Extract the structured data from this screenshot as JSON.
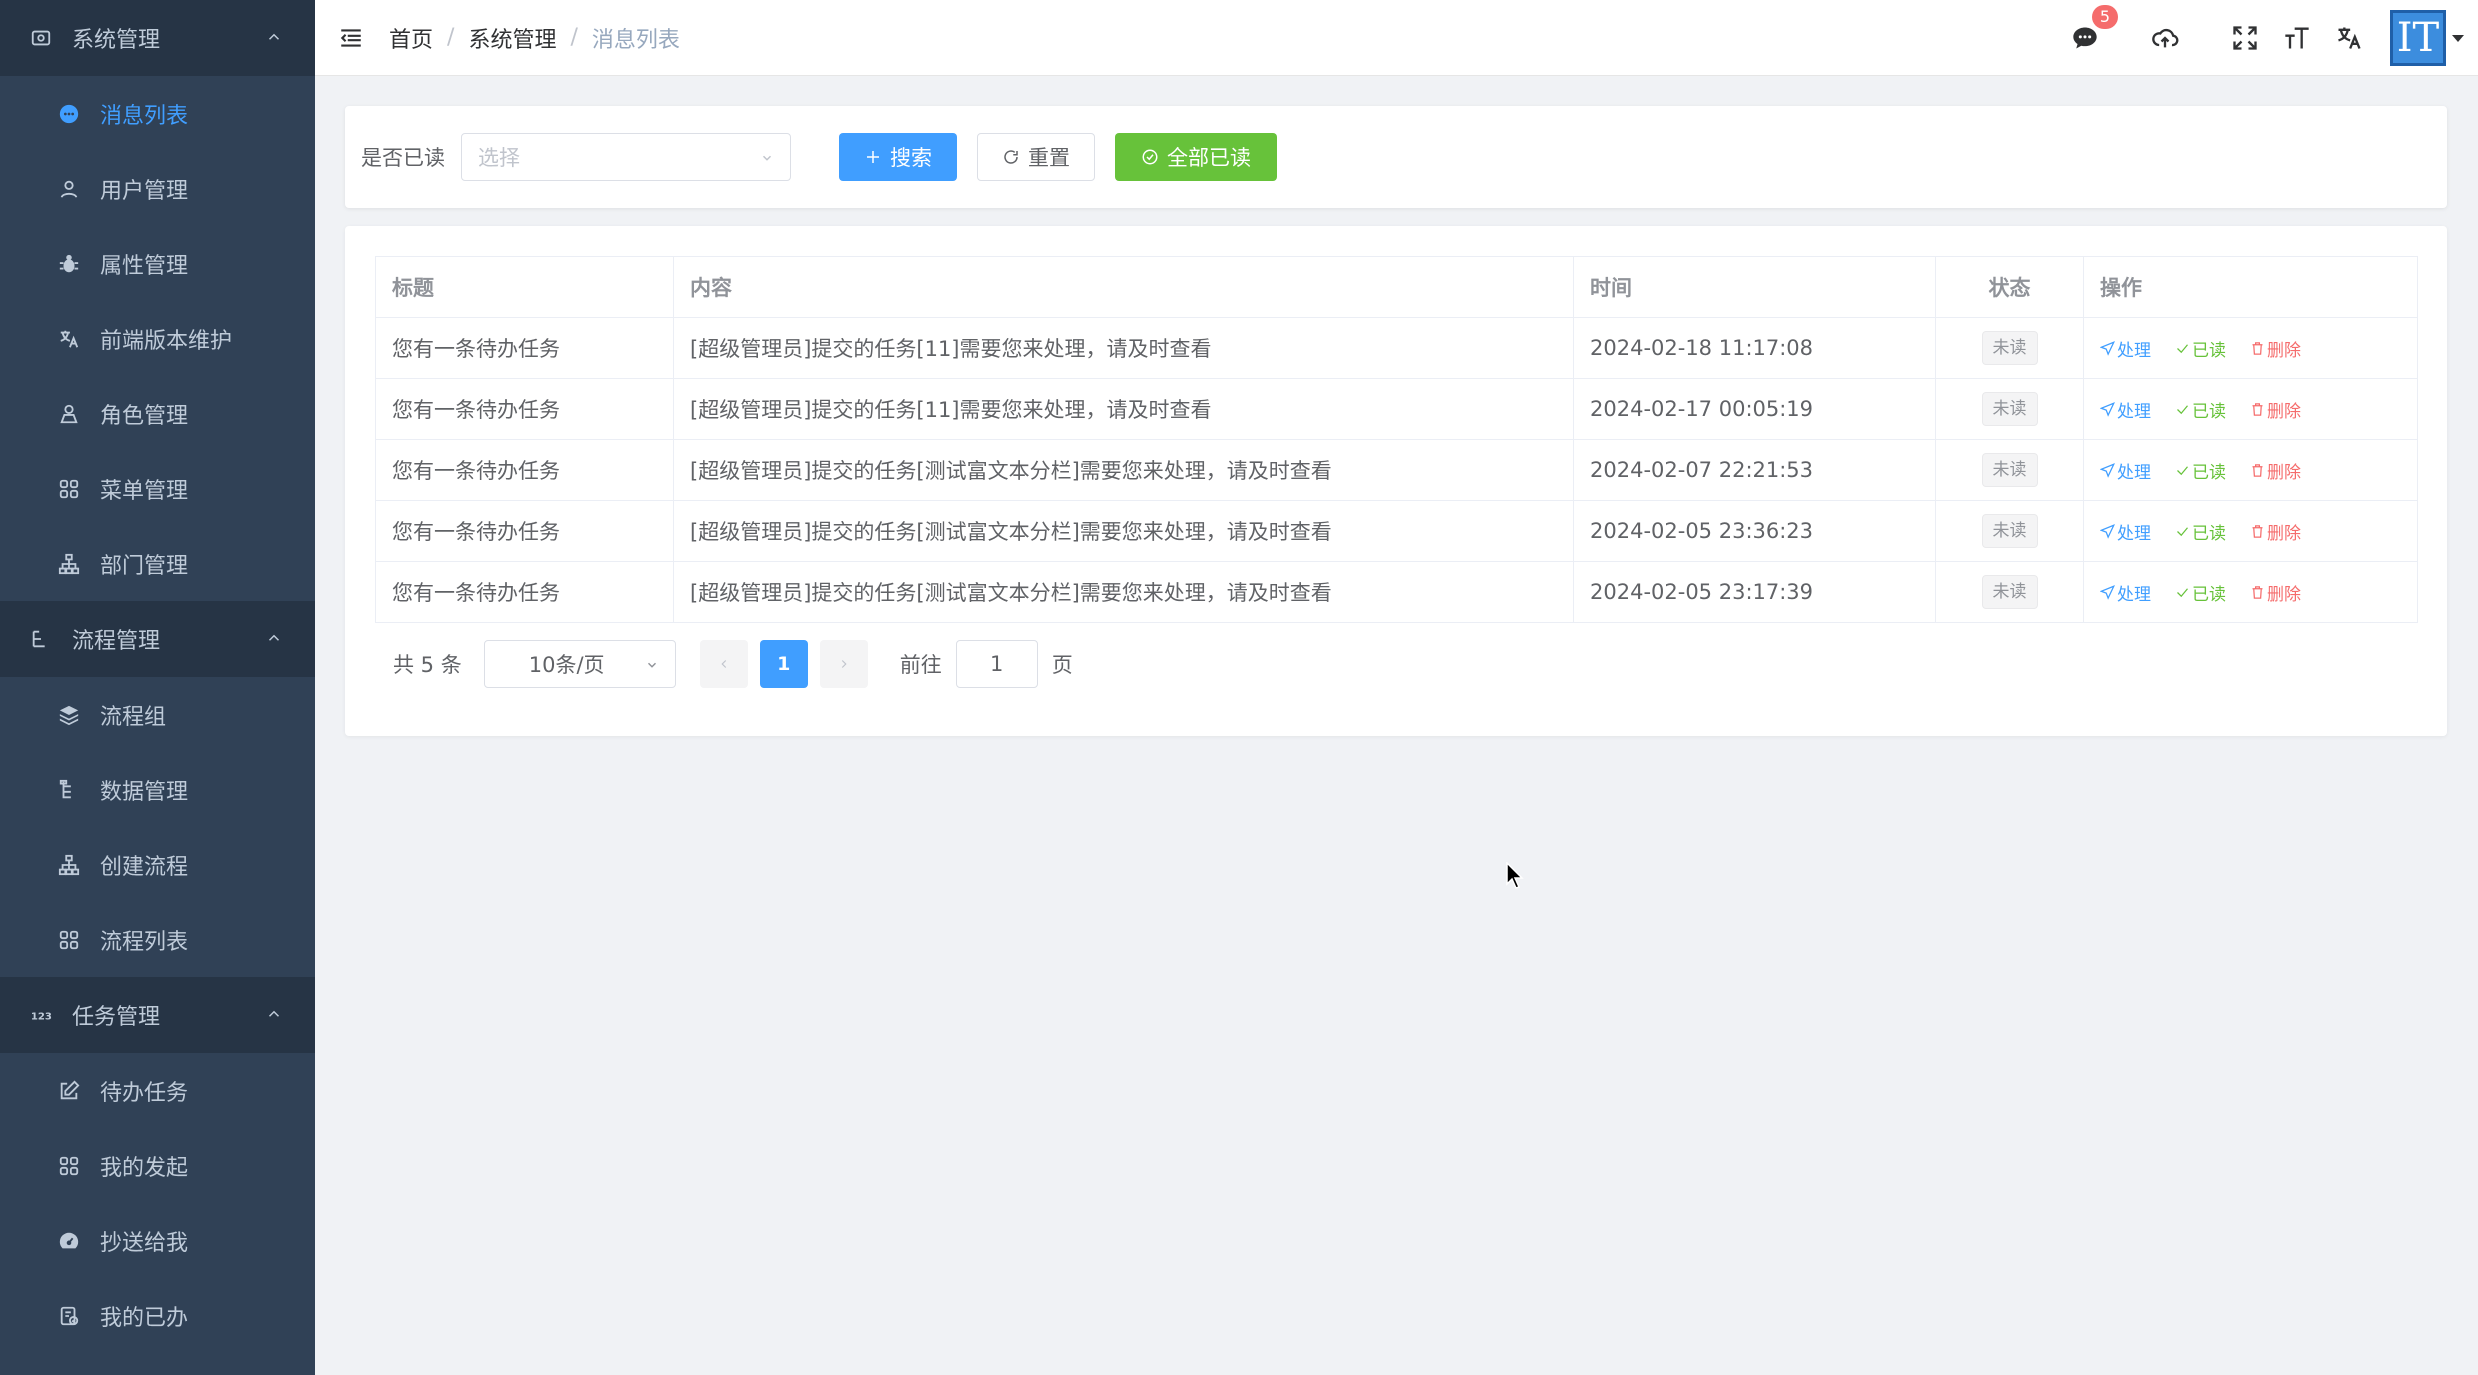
{
  "sidebar": {
    "groups": [
      {
        "title": "系统管理",
        "icon": "dashboard-icon",
        "items": [
          {
            "label": "消息列表",
            "icon": "message-icon",
            "active": true
          },
          {
            "label": "用户管理",
            "icon": "user-icon"
          },
          {
            "label": "属性管理",
            "icon": "bug-icon"
          },
          {
            "label": "前端版本维护",
            "icon": "language-icon"
          },
          {
            "label": "角色管理",
            "icon": "peoples-icon"
          },
          {
            "label": "菜单管理",
            "icon": "tree-table-icon"
          },
          {
            "label": "部门管理",
            "icon": "tree-icon"
          }
        ]
      },
      {
        "title": "流程管理",
        "icon": "flow-icon",
        "items": [
          {
            "label": "流程组",
            "icon": "layers-icon"
          },
          {
            "label": "数据管理",
            "icon": "list-tree-icon"
          },
          {
            "label": "创建流程",
            "icon": "tree-icon"
          },
          {
            "label": "流程列表",
            "icon": "grid-icon"
          }
        ]
      },
      {
        "title": "任务管理",
        "icon": "number-icon",
        "items": [
          {
            "label": "待办任务",
            "icon": "edit-icon"
          },
          {
            "label": "我的发起",
            "icon": "grid-icon"
          },
          {
            "label": "抄送给我",
            "icon": "dashboard-gauge-icon"
          },
          {
            "label": "我的已办",
            "icon": "finished-icon"
          }
        ]
      }
    ]
  },
  "header": {
    "breadcrumb": [
      "首页",
      "系统管理",
      "消息列表"
    ],
    "separator": "/",
    "notification_count": "5",
    "avatar_text": "IT"
  },
  "search": {
    "label": "是否已读",
    "select_placeholder": "选择",
    "search_button": "搜索",
    "reset_button": "重置",
    "read_all_button": "全部已读"
  },
  "table": {
    "columns": [
      "标题",
      "内容",
      "时间",
      "状态",
      "操作"
    ],
    "rows": [
      {
        "title": "您有一条待办任务",
        "content": "[超级管理员]提交的任务[11]需要您来处理，请及时查看",
        "time": "2024-02-18 11:17:08",
        "status": "未读"
      },
      {
        "title": "您有一条待办任务",
        "content": "[超级管理员]提交的任务[11]需要您来处理，请及时查看",
        "time": "2024-02-17 00:05:19",
        "status": "未读"
      },
      {
        "title": "您有一条待办任务",
        "content": "[超级管理员]提交的任务[测试富文本分栏]需要您来处理，请及时查看",
        "time": "2024-02-07 22:21:53",
        "status": "未读"
      },
      {
        "title": "您有一条待办任务",
        "content": "[超级管理员]提交的任务[测试富文本分栏]需要您来处理，请及时查看",
        "time": "2024-02-05 23:36:23",
        "status": "未读"
      },
      {
        "title": "您有一条待办任务",
        "content": "[超级管理员]提交的任务[测试富文本分栏]需要您来处理，请及时查看",
        "time": "2024-02-05 23:17:39",
        "status": "未读"
      }
    ],
    "actions": {
      "process": "处理",
      "read": "已读",
      "delete": "删除"
    }
  },
  "pagination": {
    "total": "共 5 条",
    "page_size": "10条/页",
    "current_page": "1",
    "goto_label": "前往",
    "goto_value": "1",
    "page_suffix": "页"
  },
  "colors": {
    "sidebar_bg": "#304156",
    "sidebar_group_bg": "#263445",
    "primary": "#409eff",
    "success": "#67c23a",
    "danger": "#f56c6c"
  }
}
